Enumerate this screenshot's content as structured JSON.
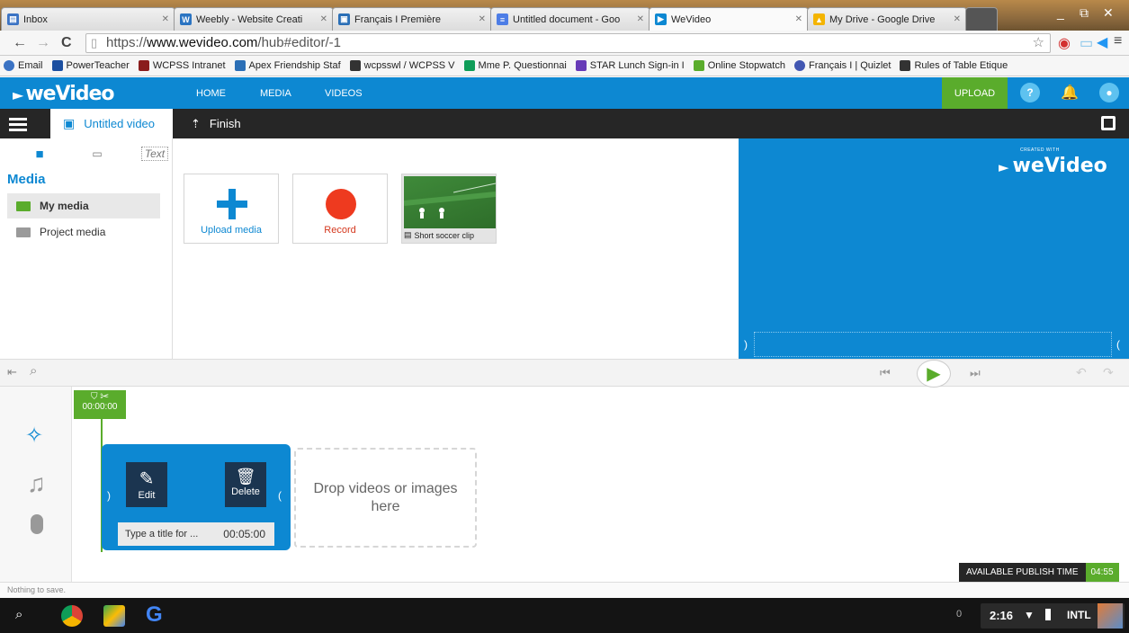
{
  "browser": {
    "tabs": [
      {
        "label": "Inbox",
        "color": "#3b73c4",
        "active": false
      },
      {
        "label": "Weebly - Website Creati",
        "color": "#2b74c2",
        "active": false
      },
      {
        "label": "Français I Première",
        "color": "#2b6fb6",
        "active": false
      },
      {
        "label": "Untitled document - Goo",
        "color": "#4d7de6",
        "active": false
      },
      {
        "label": "WeVideo",
        "color": "#0d88d2",
        "active": true
      },
      {
        "label": "My Drive - Google Drive",
        "color": "#f4b400",
        "active": false
      }
    ],
    "url_prefix": "https://",
    "url_domain": "www.wevideo.com",
    "url_path": "/hub#editor/-1",
    "bookmarks": [
      {
        "label": "Email",
        "color": "#3b73c4"
      },
      {
        "label": "PowerTeacher",
        "color": "#1c4fa0"
      },
      {
        "label": "WCPSS Intranet",
        "color": "#8a1d1d"
      },
      {
        "label": "Apex Friendship Staf",
        "color": "#2b6fb6"
      },
      {
        "label": "wcpsswl / WCPSS V",
        "color": "#333333"
      },
      {
        "label": "Mme P. Questionnai",
        "color": "#0f9d58"
      },
      {
        "label": "STAR Lunch Sign-in I",
        "color": "#673ab7"
      },
      {
        "label": "Online Stopwatch",
        "color": "#5aac2c"
      },
      {
        "label": "Français I | Quizlet",
        "color": "#4257b2"
      },
      {
        "label": "Rules of Table Etique",
        "color": "#333333"
      }
    ]
  },
  "header": {
    "logo": "weVideo",
    "nav": [
      "HOME",
      "MEDIA",
      "VIDEOS"
    ],
    "upload_label": "UPLOAD"
  },
  "editor": {
    "project_title": "Untitled video",
    "finish_label": "Finish"
  },
  "media_panel": {
    "title": "Media",
    "tab_text": "Text",
    "items": [
      "My media",
      "Project media"
    ],
    "tiles": {
      "upload": "Upload media",
      "record": "Record",
      "clip": "Short soccer clip"
    }
  },
  "preview": {
    "logo": "weVideo",
    "caption": "CREATED WITH"
  },
  "timeline": {
    "playhead_time": "00:00:00",
    "edit_label": "Edit",
    "delete_label": "Delete",
    "title_placeholder": "Type a title for ...",
    "clip_duration": "00:05:00",
    "drop_text": "Drop videos or images here",
    "publish_label": "AVAILABLE PUBLISH TIME",
    "publish_time": "04:55"
  },
  "status": "Nothing to save.",
  "shelf": {
    "notification_count": "0",
    "time": "2:16",
    "input_method": "INTL"
  }
}
